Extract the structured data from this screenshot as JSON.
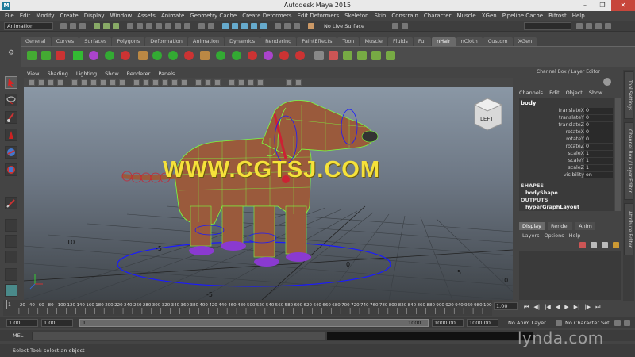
{
  "window": {
    "title": "Autodesk Maya 2015",
    "logo": "M"
  },
  "menubar": [
    "File",
    "Edit",
    "Modify",
    "Create",
    "Display",
    "Window",
    "Assets",
    "Animate",
    "Geometry Cache",
    "Create Deformers",
    "Edit Deformers",
    "Skeleton",
    "Skin",
    "Constrain",
    "Character",
    "Muscle",
    "XGen",
    "Pipeline Cache",
    "Bifrost",
    "Help"
  ],
  "statusline": {
    "mode": "Animation",
    "live_surface": "No Live Surface"
  },
  "shelf_tabs": [
    {
      "label": "General",
      "active": false
    },
    {
      "label": "Curves",
      "active": false
    },
    {
      "label": "Surfaces",
      "active": false
    },
    {
      "label": "Polygons",
      "active": false
    },
    {
      "label": "Deformation",
      "active": false
    },
    {
      "label": "Animation",
      "active": false
    },
    {
      "label": "Dynamics",
      "active": false
    },
    {
      "label": "Rendering",
      "active": false
    },
    {
      "label": "PaintEffects",
      "active": false
    },
    {
      "label": "Toon",
      "active": false
    },
    {
      "label": "Muscle",
      "active": false
    },
    {
      "label": "Fluids",
      "active": false
    },
    {
      "label": "Fur",
      "active": false
    },
    {
      "label": "nHair",
      "active": true
    },
    {
      "label": "nCloth",
      "active": false
    },
    {
      "label": "Custom",
      "active": false
    },
    {
      "label": "XGen",
      "active": false
    }
  ],
  "viewport": {
    "menu": [
      "View",
      "Shading",
      "Lighting",
      "Show",
      "Renderer",
      "Panels"
    ],
    "viewcube_label": "LEFT",
    "grid_labels": [
      "10",
      "-5",
      "0",
      "5",
      "-5",
      "10"
    ],
    "watermark": "WWW.CGTSJ.COM",
    "colors": {
      "wire": "#7cff3c",
      "curves": "#1a1aff",
      "controls": "#cc2233"
    }
  },
  "channel_box": {
    "header": "Channel Box / Layer Editor",
    "menu": [
      "Channels",
      "Edit",
      "Object",
      "Show"
    ],
    "node": "body",
    "attributes": [
      {
        "name": "translateX",
        "value": "0"
      },
      {
        "name": "translateY",
        "value": "0"
      },
      {
        "name": "translateZ",
        "value": "0"
      },
      {
        "name": "rotateX",
        "value": "0"
      },
      {
        "name": "rotateY",
        "value": "0"
      },
      {
        "name": "rotateZ",
        "value": "0"
      },
      {
        "name": "scaleX",
        "value": "1"
      },
      {
        "name": "scaleY",
        "value": "1"
      },
      {
        "name": "scaleZ",
        "value": "1"
      },
      {
        "name": "visibility",
        "value": "on"
      }
    ],
    "shapes_header": "SHAPES",
    "shape": "bodyShape",
    "outputs_header": "OUTPUTS",
    "output": "hyperGraphLayout"
  },
  "side_tabs": [
    "Tool Settings",
    "Channel Box / Layer Editor",
    "Attribute Editor"
  ],
  "layer_editor": {
    "tabs": [
      {
        "label": "Display",
        "active": true
      },
      {
        "label": "Render",
        "active": false
      },
      {
        "label": "Anim",
        "active": false
      }
    ],
    "menu": [
      "Layers",
      "Options",
      "Help"
    ]
  },
  "timeline": {
    "ticks": [
      "20",
      "40",
      "60",
      "80",
      "100",
      "120",
      "140",
      "160",
      "180",
      "200",
      "220",
      "240",
      "260",
      "280",
      "300",
      "320",
      "340",
      "360",
      "380",
      "400",
      "420",
      "440",
      "460",
      "480",
      "500",
      "520",
      "540",
      "560",
      "580",
      "600",
      "620",
      "640",
      "660",
      "680",
      "700",
      "720",
      "740",
      "760",
      "780",
      "800",
      "820",
      "840",
      "860",
      "880",
      "900",
      "920",
      "940",
      "960",
      "980",
      "1000"
    ],
    "first_tick": "1",
    "current_time": "1.00"
  },
  "range": {
    "start": "1.00",
    "playback_start": "1.00",
    "slider_start": "1",
    "slider_end": "1000",
    "playback_end": "1000.00",
    "end": "1000.00",
    "anim_layer": "No Anim Layer",
    "character_set": "No Character Set"
  },
  "command_line": {
    "label": "MEL"
  },
  "help_line": "Select Tool: select an object",
  "brand": "lynda.com"
}
